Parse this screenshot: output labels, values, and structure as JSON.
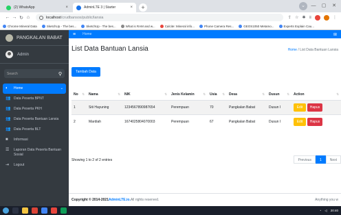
{
  "browser": {
    "tabs": [
      {
        "label": "(2) WhatsApp",
        "color": "#25d366",
        "close": "×"
      },
      {
        "label": "AdminLTE 3 | Starter",
        "color": "#1a73e8",
        "close": "×"
      }
    ],
    "new_tab": "+",
    "url_host": "localhost",
    "url_path": "/crudbansos/public/lansia",
    "bookmarks": [
      {
        "label": "Chrome Mineral Data",
        "color": "#4285f4"
      },
      {
        "label": "SketchUp - The bes...",
        "color": "#4285f4"
      },
      {
        "label": "SketchUp - The bes...",
        "color": "#4285f4"
      },
      {
        "label": "What is RAM and w...",
        "color": "#888888"
      },
      {
        "label": "Calcite: Mineral info...",
        "color": "#e8453c"
      },
      {
        "label": "Phone Camera Res...",
        "color": "#4285f4"
      },
      {
        "label": "GEOS1050 Metamo...",
        "color": "#4285f4"
      },
      {
        "label": "Experts Explain Cau...",
        "color": "#4285f4"
      }
    ]
  },
  "sidebar": {
    "brand": "PANGKALAN BABAT",
    "user": "Admin",
    "search_placeholder": "Search",
    "items": [
      {
        "label": "Home",
        "icon": "gauge-icon",
        "glyph": "◐"
      },
      {
        "label": "Data Peserta BPNT",
        "icon": "users-icon",
        "glyph": "👥"
      },
      {
        "label": "Data Peserta PKH",
        "icon": "users-icon",
        "glyph": "👥"
      },
      {
        "label": "Data Peserta Bantuan Lansia",
        "icon": "users-icon",
        "glyph": "👥"
      },
      {
        "label": "Data Peserta BLT",
        "icon": "users-icon",
        "glyph": "👥"
      },
      {
        "label": "Informasi",
        "icon": "book-icon",
        "glyph": "■"
      },
      {
        "label": "Laporan Data Peserta Bantuan Sosial",
        "icon": "list-icon",
        "glyph": "☰"
      },
      {
        "label": "Logout",
        "icon": "logout-icon",
        "glyph": "⇥"
      }
    ]
  },
  "topnav": {
    "home": "Home"
  },
  "page": {
    "title": "List Data Bantuan Lansia",
    "breadcrumb_home": "Home",
    "breadcrumb_sep": "/",
    "breadcrumb_current": "List Data Bantuan Lansia",
    "add_button": "Tambah Data"
  },
  "table": {
    "columns": [
      "No",
      "Nama",
      "NIK",
      "Jenis Kelamin",
      "Usia",
      "Desa",
      "Dusun",
      "Action"
    ],
    "rows": [
      [
        "1",
        "Siti Hayuning",
        "1234567890987654",
        "Perempuan",
        "70",
        "Pangkalan Babat",
        "Dusun I"
      ],
      [
        "2",
        "Mardiah",
        "1674025804070003",
        "Perempuan",
        "67",
        "Pangkalan Babat",
        "Dusun I"
      ]
    ],
    "edit_label": "Edit",
    "delete_label": "Hapus",
    "info": "Showing 1 to 2 of 2 entries",
    "pager": {
      "previous": "Previous",
      "current": "1",
      "next": "Next"
    }
  },
  "footer": {
    "copyright": "Copyright © 2014-2021 ",
    "brand_link": "AdminLTE.io.",
    "rights": " All rights reserved.",
    "right_text": "Anything you w"
  },
  "taskbar": {
    "time": "20:40"
  },
  "colors": {
    "primary": "#007bff",
    "sidebar": "#343a40",
    "warning": "#ffc107",
    "danger": "#dc3545"
  }
}
